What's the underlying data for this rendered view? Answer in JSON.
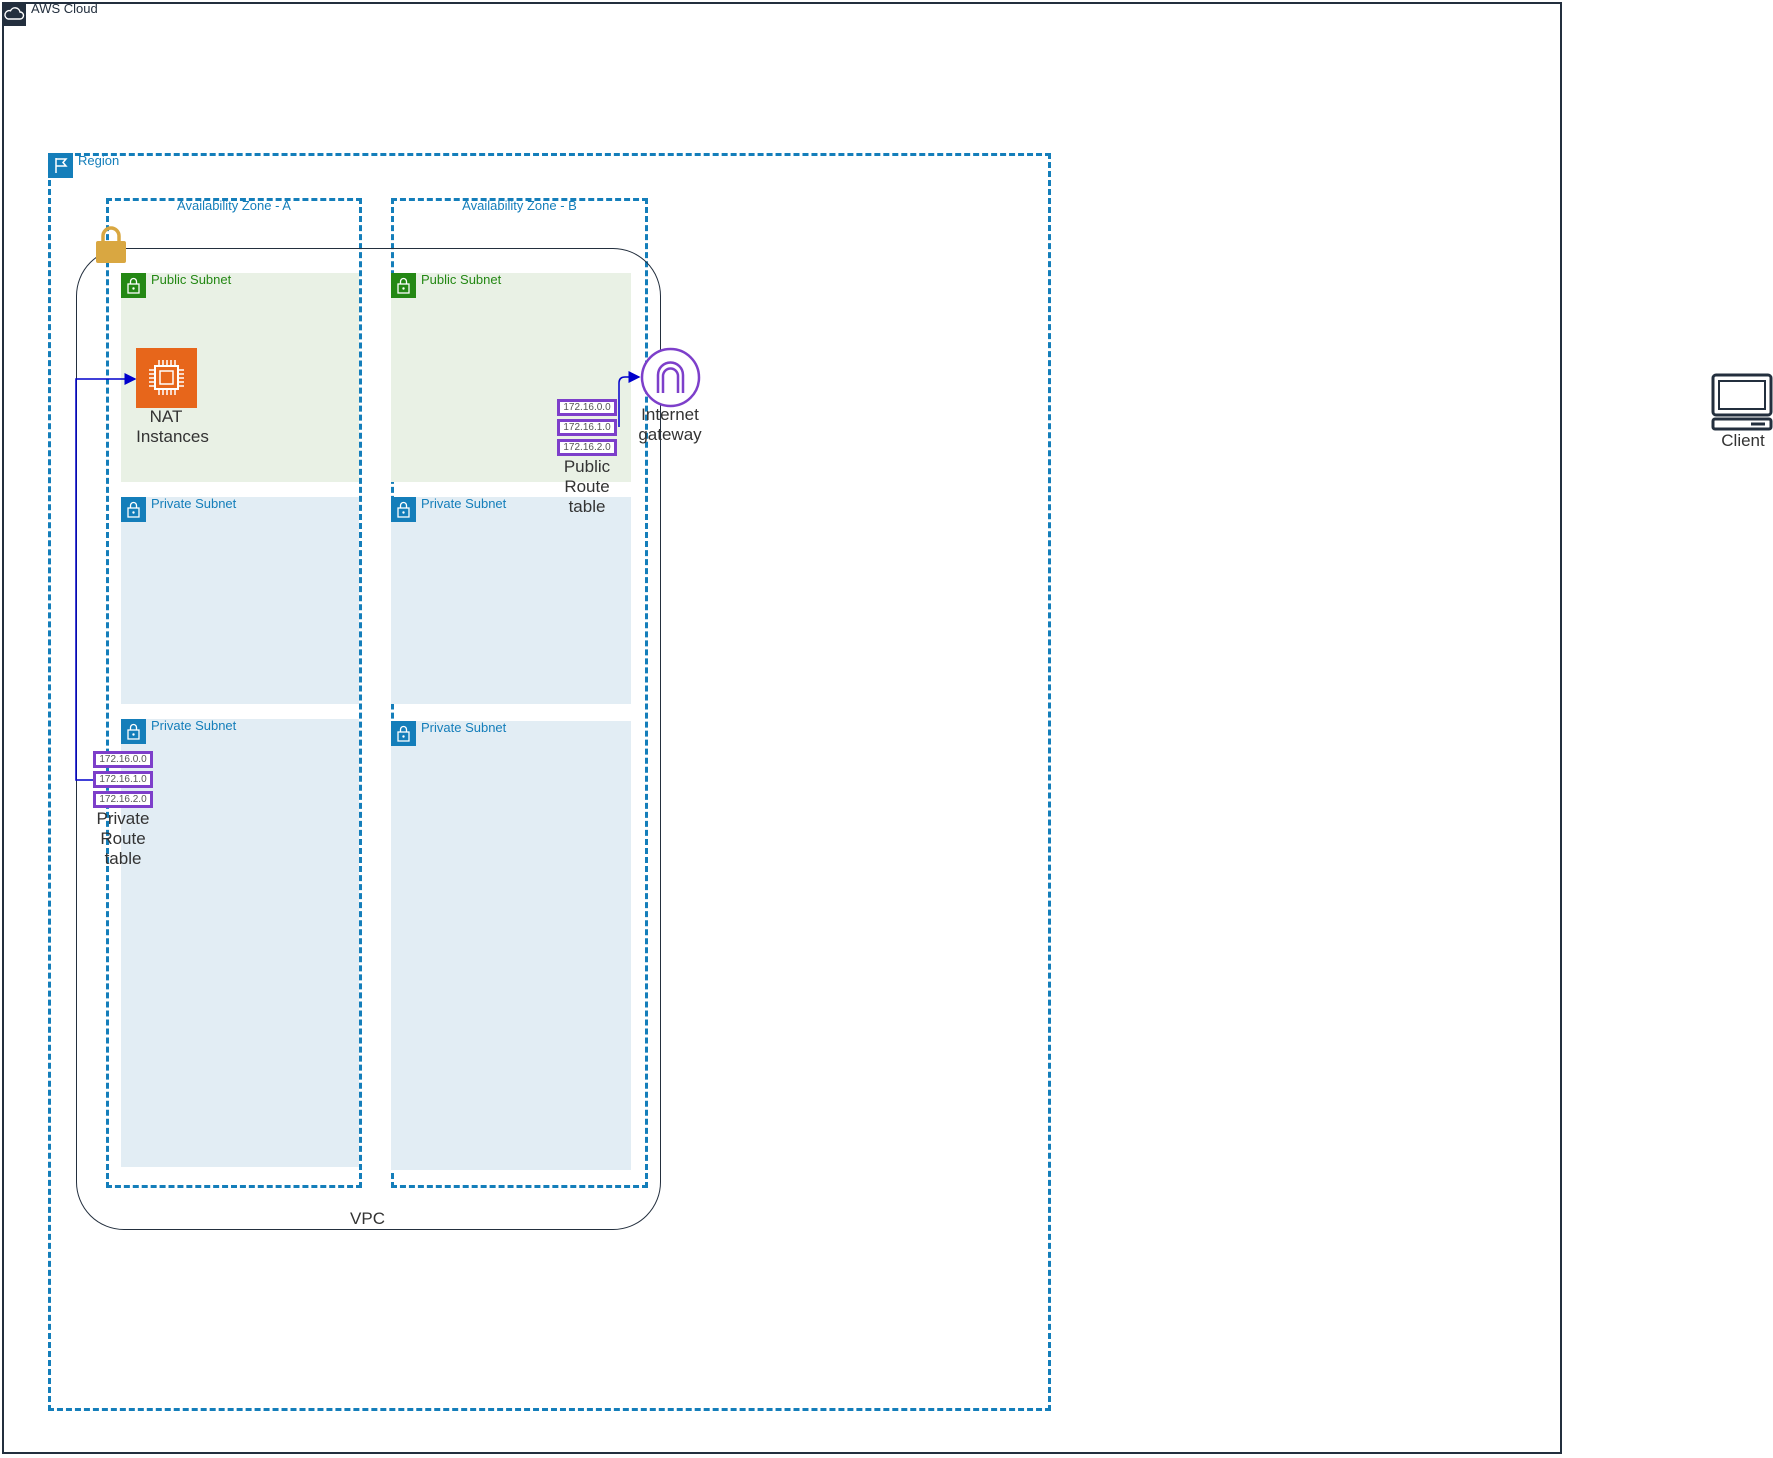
{
  "labels": {
    "aws_cloud": "AWS Cloud",
    "region": "Region",
    "az_a": "Availability Zone - A",
    "az_b": "Availability Zone - B",
    "vpc": "VPC",
    "client": "Client"
  },
  "subnets": {
    "a_public": "Public Subnet",
    "a_private_1": "Private Subnet",
    "a_private_2": "Private Subnet",
    "b_public": "Public Subnet",
    "b_private_1": "Private Subnet",
    "b_private_2": "Private Subnet"
  },
  "nat": {
    "line1": "NAT",
    "line2": "Instances"
  },
  "igw": {
    "line1": "Internet",
    "line2": "gateway"
  },
  "public_route_table": {
    "routes": [
      "172.16.0.0",
      "172.16.1.0",
      "172.16.2.0"
    ],
    "label_lines": [
      "Public",
      "Route",
      "table"
    ]
  },
  "private_route_table": {
    "routes": [
      "172.16.0.0",
      "172.16.1.0",
      "172.16.2.0"
    ],
    "label_lines": [
      "Private",
      "Route",
      "table"
    ]
  },
  "colors": {
    "aws_dark": "#232f3e",
    "region_blue": "#147eba",
    "public_green": "#248814",
    "public_fill": "#e9f1e5",
    "private_fill": "#e2edf4",
    "route_purple": "#7d3fca",
    "ec2_orange": "#e7661b",
    "vpc_lock_gold": "#d9a741",
    "arrow_blue": "#0000cc"
  }
}
